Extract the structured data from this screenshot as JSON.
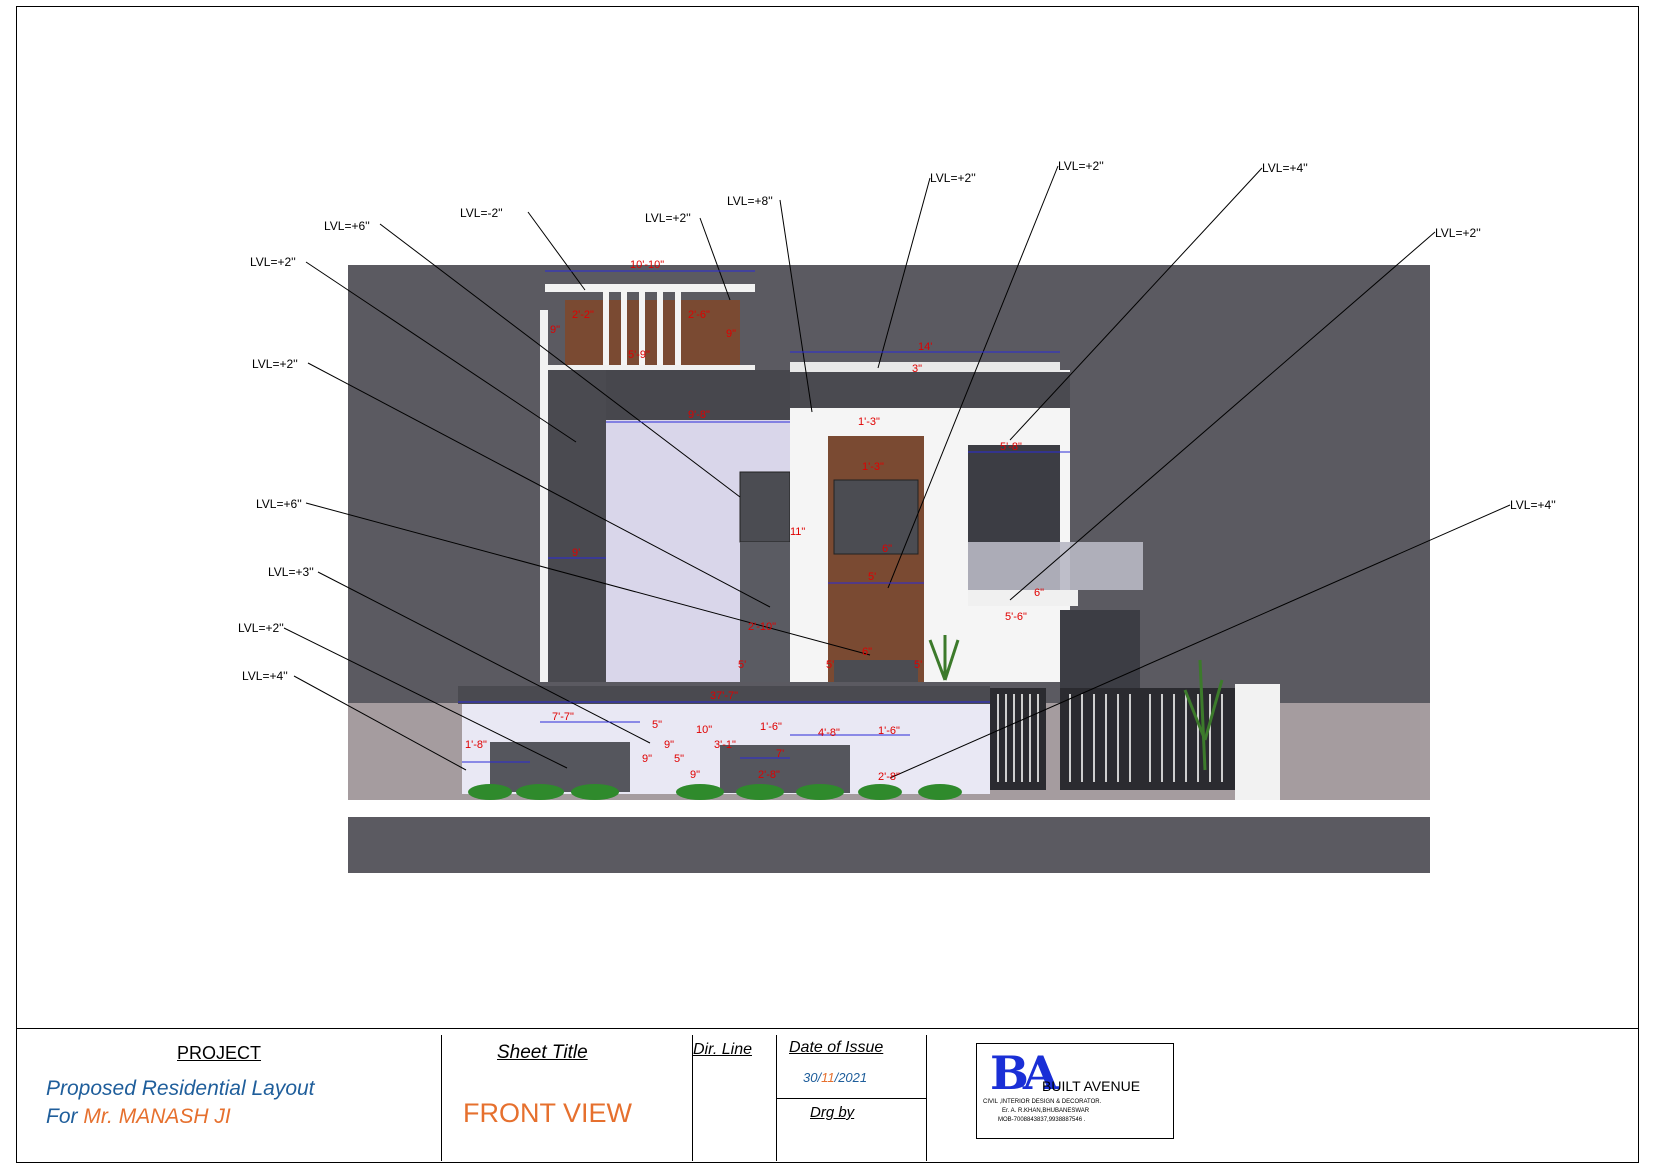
{
  "drawing": {
    "levels": [
      {
        "label": "LVL=-2''"
      },
      {
        "label": "LVL=+2''"
      },
      {
        "label": "LVL=+8''"
      },
      {
        "label": "LVL=+2''"
      },
      {
        "label": "LVL=+2''"
      },
      {
        "label": "LVL=+4''"
      },
      {
        "label": "LVL=+6''"
      },
      {
        "label": "LVL=+2''"
      },
      {
        "label": "LVL=+2''"
      },
      {
        "label": "LVL=+2''"
      },
      {
        "label": "LVL=+6''"
      },
      {
        "label": "LVL=+4''"
      },
      {
        "label": "LVL=+3''"
      },
      {
        "label": "LVL=+2''"
      },
      {
        "label": "LVL=+4''"
      }
    ],
    "dimensions": [
      "10'-10\"",
      "2'-2\"",
      "2'-6\"",
      "9\"",
      "9\"",
      "5'-9\"",
      "14'",
      "3\"",
      "9'-8\"",
      "1'-3\"",
      "1'-3\"",
      "5'-8\"",
      "6\"",
      "11\"",
      "9'",
      "5'",
      "6\"",
      "2'-10\"",
      "5'",
      "5'",
      "5'",
      "5'-6\"",
      "6\"",
      "37'-7\"",
      "7'-7\"",
      "5\"",
      "10\"",
      "1'-6\"",
      "4'-8\"",
      "1'-6\"",
      "9\"",
      "9\"",
      "7'",
      "5\"",
      "9\"",
      "2'-8\"",
      "2'-8\"",
      "1'-8\"",
      "3'-1\""
    ]
  },
  "titleblock": {
    "project_label": "PROJECT",
    "project_line1": "Proposed Residential Layout",
    "project_for": "For",
    "client": "Mr. MANASH  JI",
    "sheet_title_label": "Sheet Title",
    "sheet_title": "FRONT VIEW",
    "dir_line_label": "Dir. Line",
    "date_label": "Date of Issue",
    "date_day": "30/",
    "date_month": "11",
    "date_year": "/2021",
    "drg_by_label": "Drg by",
    "logo_mark": "BA",
    "company": "BUILT AVENUE",
    "company_line1": "CIVIL ,INTERIOR DESIGN & DECORATOR.",
    "company_line2": "Er. A. R.KHAN,BHUBANESWAR",
    "company_line3": "MOB-7008843837,9938887546 ."
  },
  "colors": {
    "background_panel": "#5b5a61",
    "facade_lavender": "#d9d6ea",
    "wood": "#7a4a32",
    "stone": "#3c3d44",
    "title_blue": "#1f5e9b",
    "accent_orange": "#e6702e",
    "dim_red": "#e00000",
    "dim_blue": "#2a2ad8"
  }
}
